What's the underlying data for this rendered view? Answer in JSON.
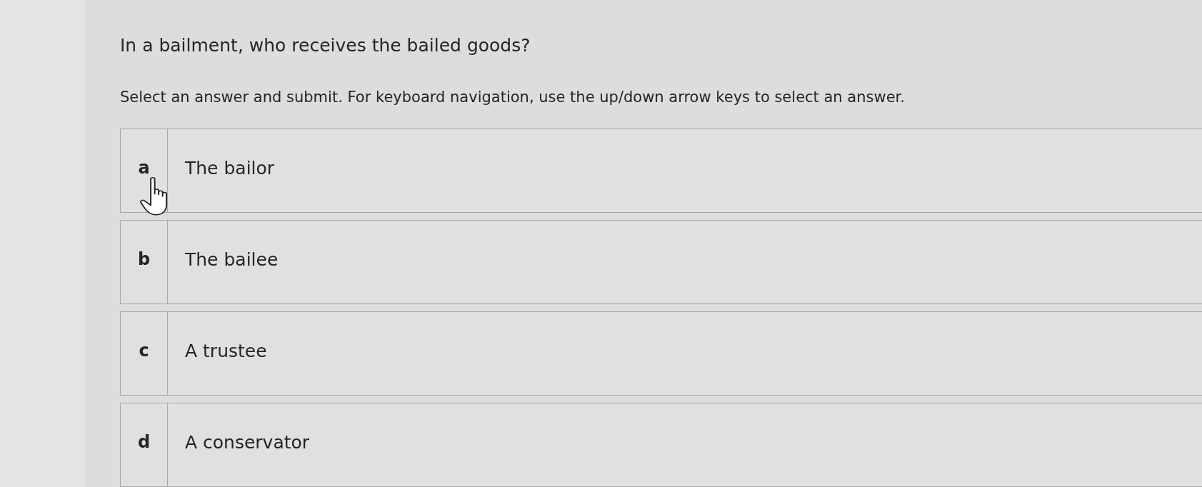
{
  "question": "In a bailment, who receives the bailed goods?",
  "instructions": "Select an answer and submit. For keyboard navigation, use the up/down arrow keys to select an answer.",
  "options": [
    {
      "letter": "a",
      "text": "The bailor",
      "selected": false
    },
    {
      "letter": "b",
      "text": "The bailee",
      "selected": false
    },
    {
      "letter": "c",
      "text": "A trustee",
      "selected": false
    },
    {
      "letter": "d",
      "text": "A conservator",
      "selected": false
    }
  ]
}
